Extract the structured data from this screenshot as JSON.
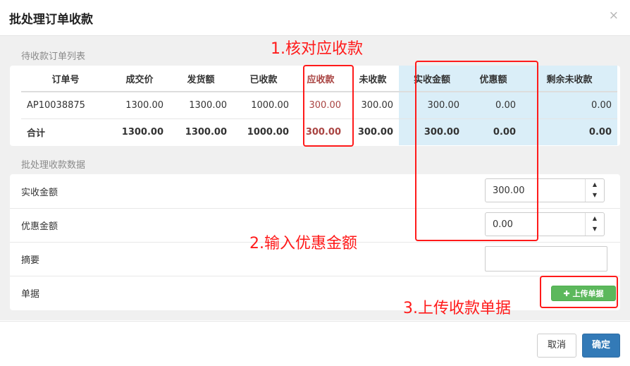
{
  "dialog": {
    "title": "批处理订单收款",
    "close": "×"
  },
  "section1": {
    "title": "待收款订单列表"
  },
  "table": {
    "headers": [
      "订单号",
      "成交价",
      "发货额",
      "已收款",
      "应收款",
      "未收款",
      "实收金额",
      "优惠额",
      "剩余未收款"
    ],
    "rows": [
      [
        "AP10038875",
        "1300.00",
        "1300.00",
        "1000.00",
        "300.00",
        "300.00",
        "300.00",
        "0.00",
        "0.00"
      ]
    ],
    "total": [
      "合计",
      "1300.00",
      "1300.00",
      "1000.00",
      "300.00",
      "300.00",
      "300.00",
      "0.00",
      "0.00"
    ]
  },
  "section2": {
    "title": "批处理收款数据"
  },
  "form": {
    "actual_label": "实收金额",
    "actual_value": "300.00",
    "discount_label": "优惠金额",
    "discount_value": "0.00",
    "summary_label": "摘要",
    "summary_value": "",
    "doc_label": "单据",
    "upload_label": "上传单据"
  },
  "spinner": {
    "up": "▲",
    "down": "▼"
  },
  "footer": {
    "cancel": "取消",
    "ok": "确定"
  },
  "annotations": {
    "a1": "1.核对应收款",
    "a2": "2.输入优惠金额",
    "a3": "3.上传收款单据"
  },
  "colors": {
    "annotation": "#ff1a1a",
    "primary": "#337ab7",
    "success": "#5cb85c",
    "highlight": "#daeef8",
    "receivable": "#a94442"
  }
}
